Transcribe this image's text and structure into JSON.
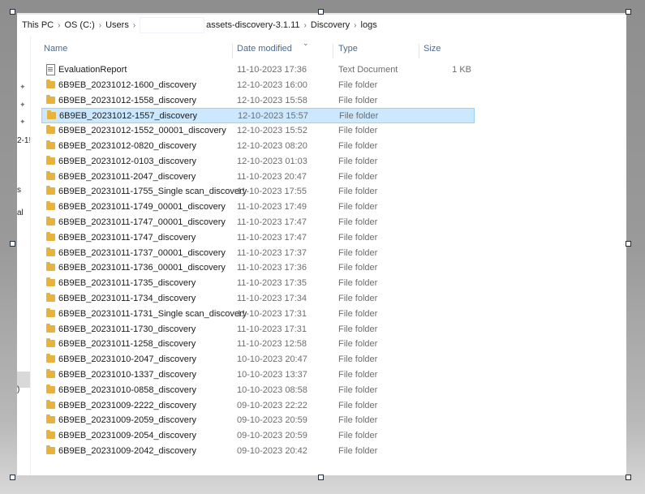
{
  "breadcrumb": [
    "This PC",
    "OS (C:)",
    "Users",
    "",
    "assets-discovery-3.1.11",
    "Discovery",
    "logs"
  ],
  "nav_fragments": [
    "2-1!",
    "s",
    "al",
    ")"
  ],
  "columns": {
    "name": "Name",
    "date": "Date modified",
    "type": "Type",
    "size": "Size"
  },
  "files": [
    {
      "name": "EvaluationReport",
      "date": "11-10-2023 17:36",
      "type": "Text Document",
      "size": "1 KB",
      "icon": "text-document-icon"
    },
    {
      "name": "6B9EB_20231012-1600_discovery",
      "date": "12-10-2023 16:00",
      "type": "File folder",
      "size": "",
      "icon": "folder-icon"
    },
    {
      "name": "6B9EB_20231012-1558_discovery",
      "date": "12-10-2023 15:58",
      "type": "File folder",
      "size": "",
      "icon": "folder-icon"
    },
    {
      "name": "6B9EB_20231012-1557_discovery",
      "date": "12-10-2023 15:57",
      "type": "File folder",
      "size": "",
      "icon": "folder-icon",
      "selected": true
    },
    {
      "name": "6B9EB_20231012-1552_00001_discovery",
      "date": "12-10-2023 15:52",
      "type": "File folder",
      "size": "",
      "icon": "folder-icon"
    },
    {
      "name": "6B9EB_20231012-0820_discovery",
      "date": "12-10-2023 08:20",
      "type": "File folder",
      "size": "",
      "icon": "folder-icon"
    },
    {
      "name": "6B9EB_20231012-0103_discovery",
      "date": "12-10-2023 01:03",
      "type": "File folder",
      "size": "",
      "icon": "folder-icon"
    },
    {
      "name": "6B9EB_20231011-2047_discovery",
      "date": "11-10-2023 20:47",
      "type": "File folder",
      "size": "",
      "icon": "folder-icon"
    },
    {
      "name": "6B9EB_20231011-1755_Single scan_discovery",
      "date": "11-10-2023 17:55",
      "type": "File folder",
      "size": "",
      "icon": "folder-icon"
    },
    {
      "name": "6B9EB_20231011-1749_00001_discovery",
      "date": "11-10-2023 17:49",
      "type": "File folder",
      "size": "",
      "icon": "folder-icon"
    },
    {
      "name": "6B9EB_20231011-1747_00001_discovery",
      "date": "11-10-2023 17:47",
      "type": "File folder",
      "size": "",
      "icon": "folder-icon"
    },
    {
      "name": "6B9EB_20231011-1747_discovery",
      "date": "11-10-2023 17:47",
      "type": "File folder",
      "size": "",
      "icon": "folder-icon"
    },
    {
      "name": "6B9EB_20231011-1737_00001_discovery",
      "date": "11-10-2023 17:37",
      "type": "File folder",
      "size": "",
      "icon": "folder-icon"
    },
    {
      "name": "6B9EB_20231011-1736_00001_discovery",
      "date": "11-10-2023 17:36",
      "type": "File folder",
      "size": "",
      "icon": "folder-icon"
    },
    {
      "name": "6B9EB_20231011-1735_discovery",
      "date": "11-10-2023 17:35",
      "type": "File folder",
      "size": "",
      "icon": "folder-icon"
    },
    {
      "name": "6B9EB_20231011-1734_discovery",
      "date": "11-10-2023 17:34",
      "type": "File folder",
      "size": "",
      "icon": "folder-icon"
    },
    {
      "name": "6B9EB_20231011-1731_Single scan_discovery",
      "date": "11-10-2023 17:31",
      "type": "File folder",
      "size": "",
      "icon": "folder-icon"
    },
    {
      "name": "6B9EB_20231011-1730_discovery",
      "date": "11-10-2023 17:31",
      "type": "File folder",
      "size": "",
      "icon": "folder-icon"
    },
    {
      "name": "6B9EB_20231011-1258_discovery",
      "date": "11-10-2023 12:58",
      "type": "File folder",
      "size": "",
      "icon": "folder-icon"
    },
    {
      "name": "6B9EB_20231010-2047_discovery",
      "date": "10-10-2023 20:47",
      "type": "File folder",
      "size": "",
      "icon": "folder-icon"
    },
    {
      "name": "6B9EB_20231010-1337_discovery",
      "date": "10-10-2023 13:37",
      "type": "File folder",
      "size": "",
      "icon": "folder-icon"
    },
    {
      "name": "6B9EB_20231010-0858_discovery",
      "date": "10-10-2023 08:58",
      "type": "File folder",
      "size": "",
      "icon": "folder-icon"
    },
    {
      "name": "6B9EB_20231009-2222_discovery",
      "date": "09-10-2023 22:22",
      "type": "File folder",
      "size": "",
      "icon": "folder-icon"
    },
    {
      "name": "6B9EB_20231009-2059_discovery",
      "date": "09-10-2023 20:59",
      "type": "File folder",
      "size": "",
      "icon": "folder-icon"
    },
    {
      "name": "6B9EB_20231009-2054_discovery",
      "date": "09-10-2023 20:59",
      "type": "File folder",
      "size": "",
      "icon": "folder-icon"
    },
    {
      "name": "6B9EB_20231009-2042_discovery",
      "date": "09-10-2023 20:42",
      "type": "File folder",
      "size": "",
      "icon": "folder-icon"
    }
  ]
}
